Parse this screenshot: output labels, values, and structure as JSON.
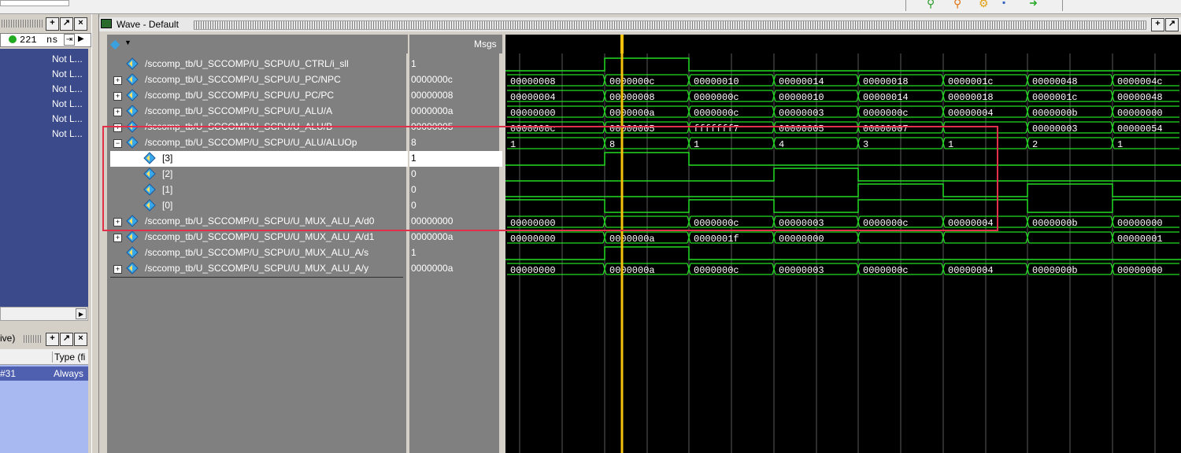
{
  "left_panel": {
    "time_value": "221",
    "time_unit": "ns",
    "not_logged_labels": [
      "Not L...",
      "Not L...",
      "Not L...",
      "Not L...",
      "Not L...",
      "Not L..."
    ]
  },
  "lower_left": {
    "title": "ive)",
    "column_header": "Type (fi",
    "row_id": "#31",
    "row_type": "Always"
  },
  "wave_window": {
    "title": "Wave - Default",
    "msgs_header": "Msgs",
    "cursor_time": 221
  },
  "signals": [
    {
      "name": "/sccomp_tb/U_SCCOMP/U_SCPU/U_CTRL/i_sll",
      "value": "1",
      "expandable": false,
      "indent": 0
    },
    {
      "name": "/sccomp_tb/U_SCCOMP/U_SCPU/U_PC/NPC",
      "value": "0000000c",
      "expandable": true,
      "indent": 0
    },
    {
      "name": "/sccomp_tb/U_SCCOMP/U_SCPU/U_PC/PC",
      "value": "00000008",
      "expandable": true,
      "indent": 0
    },
    {
      "name": "/sccomp_tb/U_SCCOMP/U_SCPU/U_ALU/A",
      "value": "0000000a",
      "expandable": true,
      "indent": 0
    },
    {
      "name": "/sccomp_tb/U_SCCOMP/U_SCPU/U_ALU/B",
      "value": "00000005",
      "expandable": true,
      "indent": 0
    },
    {
      "name": "/sccomp_tb/U_SCCOMP/U_SCPU/U_ALU/ALUOp",
      "value": "8",
      "expandable": true,
      "expanded": true,
      "indent": 0
    },
    {
      "name": "[3]",
      "value": "1",
      "expandable": false,
      "indent": 1,
      "selected": true
    },
    {
      "name": "[2]",
      "value": "0",
      "expandable": false,
      "indent": 1
    },
    {
      "name": "[1]",
      "value": "0",
      "expandable": false,
      "indent": 1
    },
    {
      "name": "[0]",
      "value": "0",
      "expandable": false,
      "indent": 1
    },
    {
      "name": "/sccomp_tb/U_SCCOMP/U_SCPU/U_MUX_ALU_A/d0",
      "value": "00000000",
      "expandable": true,
      "indent": 0
    },
    {
      "name": "/sccomp_tb/U_SCCOMP/U_SCPU/U_MUX_ALU_A/d1",
      "value": "0000000a",
      "expandable": true,
      "indent": 0
    },
    {
      "name": "/sccomp_tb/U_SCCOMP/U_SCPU/U_MUX_ALU_A/s",
      "value": "1",
      "expandable": false,
      "indent": 0
    },
    {
      "name": "/sccomp_tb/U_SCCOMP/U_SCPU/U_MUX_ALU_A/y",
      "value": "0000000a",
      "expandable": true,
      "indent": 0
    }
  ],
  "waveforms": {
    "segment_boundaries": [
      "0",
      "1",
      "2",
      "3",
      "4",
      "5",
      "6",
      "7"
    ],
    "rows": [
      {
        "type": "bit",
        "levels": [
          0,
          1,
          0,
          0,
          0,
          0,
          0,
          0
        ]
      },
      {
        "type": "bus",
        "values": [
          "00000008",
          "0000000c",
          "00000010",
          "00000014",
          "00000018",
          "0000001c",
          "00000048",
          "0000004c"
        ]
      },
      {
        "type": "bus",
        "values": [
          "00000004",
          "00000008",
          "0000000c",
          "00000010",
          "00000014",
          "00000018",
          "0000001c",
          "00000048"
        ]
      },
      {
        "type": "bus",
        "values": [
          "00000000",
          "0000000a",
          "0000000c",
          "00000003",
          "0000000c",
          "00000004",
          "0000000b",
          "00000000"
        ]
      },
      {
        "type": "bus",
        "values": [
          "0000000c",
          "00000005",
          "fffffff7",
          "00000005",
          "00000007",
          "",
          "00000003",
          "00000054"
        ]
      },
      {
        "type": "bus",
        "values": [
          "1",
          "8",
          "1",
          "4",
          "3",
          "1",
          "2",
          "1"
        ]
      },
      {
        "type": "bit",
        "levels": [
          0,
          1,
          0,
          0,
          0,
          0,
          0,
          0
        ]
      },
      {
        "type": "bit",
        "levels": [
          0,
          0,
          0,
          1,
          0,
          0,
          0,
          0
        ]
      },
      {
        "type": "bit",
        "levels": [
          0,
          0,
          0,
          0,
          1,
          0,
          1,
          0
        ]
      },
      {
        "type": "bit",
        "levels": [
          1,
          0,
          1,
          0,
          1,
          1,
          0,
          1
        ]
      },
      {
        "type": "bus",
        "values": [
          "00000000",
          "",
          "0000000c",
          "00000003",
          "0000000c",
          "00000004",
          "0000000b",
          "00000000"
        ]
      },
      {
        "type": "bus",
        "values": [
          "00000000",
          "0000000a",
          "0000001f",
          "00000000",
          "",
          "",
          "",
          "00000001"
        ]
      },
      {
        "type": "bit",
        "levels": [
          0,
          1,
          0,
          0,
          0,
          0,
          0,
          0
        ]
      },
      {
        "type": "bus",
        "values": [
          "00000000",
          "0000000a",
          "0000000c",
          "00000003",
          "0000000c",
          "00000004",
          "0000000b",
          "00000000"
        ]
      }
    ]
  },
  "colors": {
    "wave_bg": "#000000",
    "wave_green": "#22dd22",
    "cursor": "#f4c20d",
    "highlight_box": "#e0304a",
    "panel_gray": "#808080",
    "left_blue": "#3a4a8a"
  }
}
